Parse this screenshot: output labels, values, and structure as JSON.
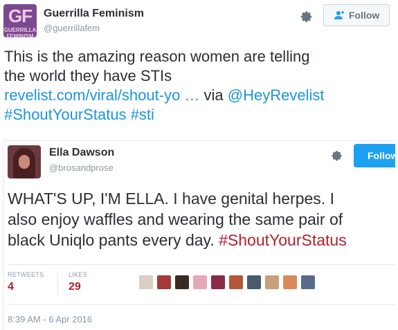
{
  "header": {
    "logo_text": "GF",
    "logo_sub": "GUERRILLA FEMINISM",
    "display_name": "Guerrilla Feminism",
    "handle": "@guerrillafem",
    "gear_icon": "gear-icon",
    "follow_label": "Follow"
  },
  "tweet": {
    "text_line1": "This is the amazing reason women are telling",
    "text_line2": "the world they have STIs",
    "link": "revelist.com/viral/shout-yo …",
    "via": "via",
    "mention": "@HeyRevelist",
    "hashtag1": "#ShoutYourStatus",
    "hashtag2": "#sti"
  },
  "embedded": {
    "display_name": "Ella Dawson",
    "handle": "@brosandprose",
    "follow_label": "Follow",
    "line1": "WHAT'S UP, I'M ELLA. I have genital herpes. I",
    "line2": "also enjoy waffles and wearing the same pair of",
    "line3_text": "black Uniqlo pants every day. ",
    "line3_hashtag": "#ShoutYourStatus",
    "retweets_label": "RETWEETS",
    "retweets_count": "4",
    "likes_label": "LIKES",
    "likes_count": "29",
    "timestamp": "8:39 AM - 6 Apr 2016"
  },
  "colors": {
    "link": "#1b95e0",
    "hashtag_red": "#b31f2c",
    "follow_blue": "#1da1f2"
  }
}
